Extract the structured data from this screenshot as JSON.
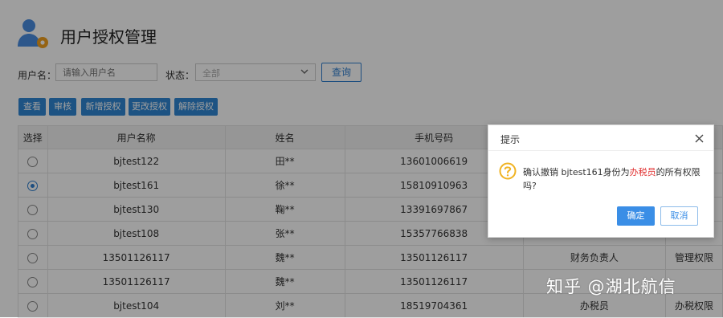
{
  "header": {
    "title": "用户授权管理",
    "icon": "user-settings-icon"
  },
  "filter": {
    "username_label": "用户名：",
    "username_placeholder": "请输入用户名",
    "status_label": "状态：",
    "status_value": "全部",
    "query_label": "查询"
  },
  "toolbar": [
    "查看",
    "审核",
    "新增授权",
    "更改授权",
    "解除授权"
  ],
  "table": {
    "headers": [
      "选择",
      "用户名称",
      "姓名",
      "手机号码",
      "",
      ""
    ],
    "rows": [
      {
        "selected": false,
        "username": "bjtest122",
        "name": "田**",
        "phone": "13601006619",
        "role": "",
        "perm": ""
      },
      {
        "selected": true,
        "username": "bjtest161",
        "name": "徐**",
        "phone": "15810910963",
        "role": "",
        "perm": ""
      },
      {
        "selected": false,
        "username": "bjtest130",
        "name": "鞠**",
        "phone": "13391697867",
        "role": "",
        "perm": ""
      },
      {
        "selected": false,
        "username": "bjtest108",
        "name": "张**",
        "phone": "15357766838",
        "role": "",
        "perm": ""
      },
      {
        "selected": false,
        "username": "13501126117",
        "name": "魏**",
        "phone": "13501126117",
        "role": "财务负责人",
        "perm": "管理权限"
      },
      {
        "selected": false,
        "username": "13501126117",
        "name": "魏**",
        "phone": "13501126117",
        "role": "",
        "perm": ""
      },
      {
        "selected": false,
        "username": "bjtest104",
        "name": "刘**",
        "phone": "18519704361",
        "role": "办税员",
        "perm": "办税权限"
      }
    ]
  },
  "dialog": {
    "title": "提示",
    "message_prefix": "确认撤销 bjtest161身份为",
    "message_highlight": "办税员",
    "message_suffix": "的所有权限吗?",
    "ok_label": "确定",
    "cancel_label": "取消"
  },
  "watermark": "知乎 @湖北航信",
  "colors": {
    "primary": "#2f86d3",
    "highlight": "#e03030",
    "warning": "#f0b323"
  }
}
